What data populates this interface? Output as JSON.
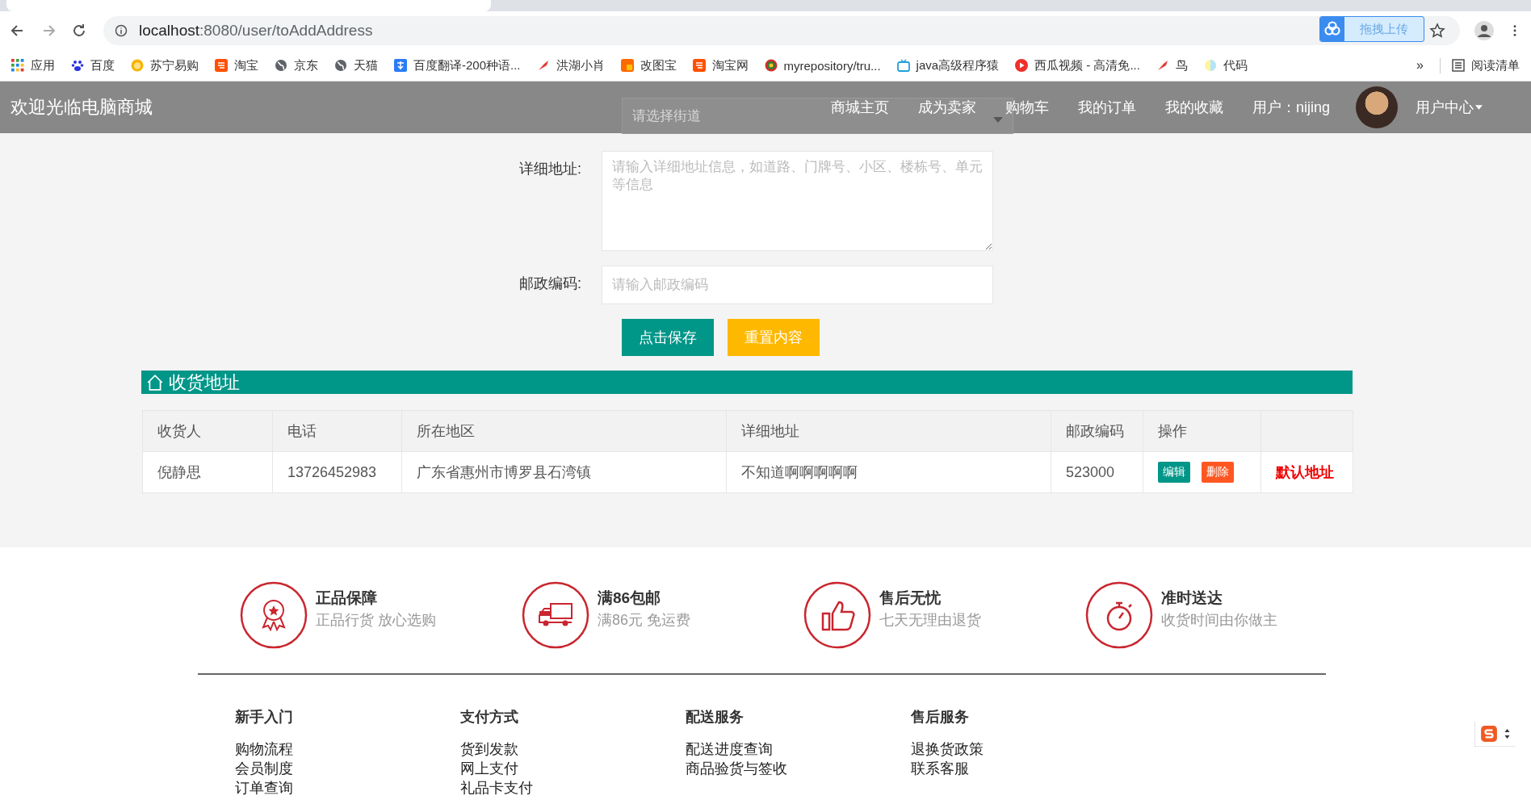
{
  "browser": {
    "url_host": "localhost",
    "url_rest": ":8080/user/toAddAddress",
    "upload_widget": "拖拽上传",
    "bookmarks": [
      "应用",
      "百度",
      "苏宁易购",
      "淘宝",
      "京东",
      "天猫",
      "百度翻译-200种语...",
      "洪湖小肖",
      "改图宝",
      "淘宝网",
      "myrepository/tru...",
      "java高级程序猿",
      "西瓜视频 - 高清免...",
      "鸟",
      "代码"
    ],
    "overflow": "»",
    "reading_list": "阅读清单"
  },
  "navbar": {
    "brand": "欢迎光临电脑商城",
    "street_select": {
      "placeholder": "请选择街道"
    },
    "links": [
      "商城主页",
      "成为卖家",
      "购物车",
      "我的订单",
      "我的收藏",
      "用户：nijing"
    ],
    "user_center": "用户中心"
  },
  "form": {
    "fields": [
      {
        "label": "详细地址:",
        "kind": "textarea",
        "placeholder": "请输入详细地址信息，如道路、门牌号、小区、楼栋号、单元等信息"
      },
      {
        "label": "邮政编码:",
        "kind": "input",
        "placeholder": "请输入邮政编码"
      }
    ],
    "buttons": [
      {
        "label": "点击保存",
        "kind": "primary"
      },
      {
        "label": "重置内容",
        "kind": "warm"
      }
    ]
  },
  "address_section": {
    "title": "收货地址",
    "columns": [
      "收货人",
      "电话",
      "所在地区",
      "详细地址",
      "邮政编码",
      "操作"
    ],
    "rows": [
      {
        "cells": [
          "倪静思",
          "13726452983",
          "广东省惠州市博罗县石湾镇",
          "不知道啊啊啊啊啊",
          "523000"
        ],
        "edit": "编辑",
        "delete": "删除",
        "default_label": "默认地址"
      }
    ]
  },
  "features": [
    {
      "title": "正品保障",
      "subtitle": "正品行货 放心选购"
    },
    {
      "title": "满86包邮",
      "subtitle": "满86元 免运费"
    },
    {
      "title": "售后无忧",
      "subtitle": "七天无理由退货"
    },
    {
      "title": "准时送达",
      "subtitle": "收货时间由你做主"
    }
  ],
  "footer": [
    {
      "title": "新手入门",
      "links": [
        "购物流程",
        "会员制度",
        "订单查询"
      ]
    },
    {
      "title": "支付方式",
      "links": [
        "货到发款",
        "网上支付",
        "礼品卡支付"
      ]
    },
    {
      "title": "配送服务",
      "links": [
        "配送进度查询",
        "商品验货与签收"
      ]
    },
    {
      "title": "售后服务",
      "links": [
        "退换货政策",
        "联系客服"
      ]
    }
  ]
}
